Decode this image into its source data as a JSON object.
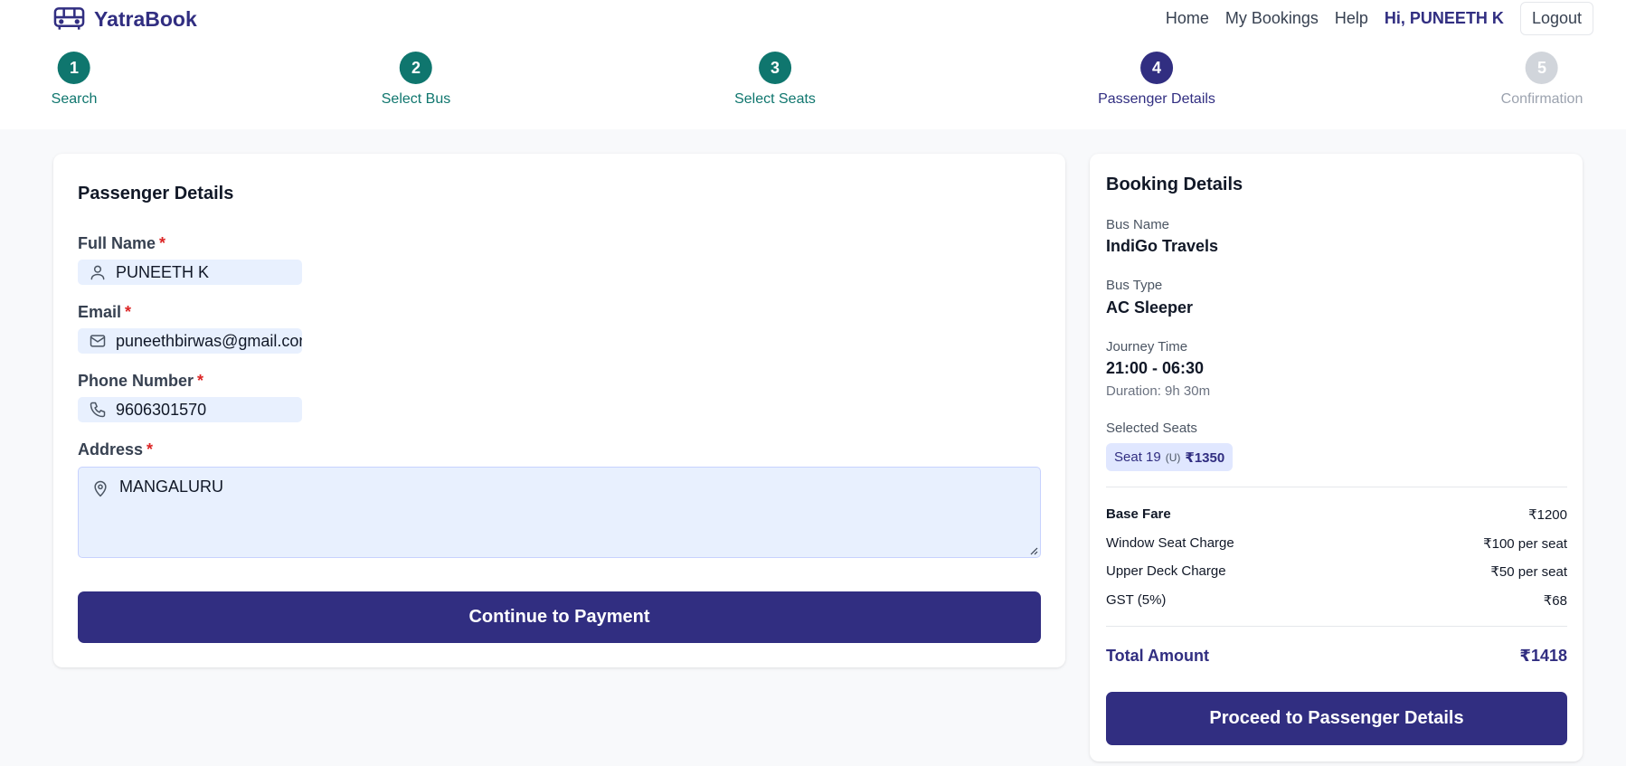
{
  "header": {
    "brand": "YatraBook",
    "nav": [
      "Home",
      "My Bookings",
      "Help"
    ],
    "greeting": "Hi, PUNEETH K",
    "logout_label": "Logout"
  },
  "steps": [
    {
      "number": "1",
      "label": "Search",
      "state": "done"
    },
    {
      "number": "2",
      "label": "Select Bus",
      "state": "done"
    },
    {
      "number": "3",
      "label": "Select Seats",
      "state": "done"
    },
    {
      "number": "4",
      "label": "Passenger Details",
      "state": "active"
    },
    {
      "number": "5",
      "label": "Confirmation",
      "state": "pending"
    }
  ],
  "form": {
    "title": "Passenger Details",
    "required_mark": "*",
    "full_name": {
      "label": "Full Name",
      "value": "PUNEETH K"
    },
    "email": {
      "label": "Email",
      "value": "puneethbirwas@gmail.com"
    },
    "phone": {
      "label": "Phone Number",
      "value": "9606301570"
    },
    "address": {
      "label": "Address",
      "value": "MANGALURU"
    },
    "continue_label": "Continue to Payment"
  },
  "booking": {
    "title": "Booking Details",
    "bus_name_label": "Bus Name",
    "bus_name": "IndiGo Travels",
    "bus_type_label": "Bus Type",
    "bus_type": "AC Sleeper",
    "journey_label": "Journey Time",
    "journey_time": "21:00 - 06:30",
    "duration": "Duration: 9h 30m",
    "seats_label": "Selected Seats",
    "seat": {
      "name": "Seat 19",
      "deck": "(U)",
      "price": "₹1350"
    },
    "fares": [
      {
        "name": "Base Fare",
        "value": "₹1200"
      },
      {
        "name": "Window Seat Charge",
        "value": "₹100 per seat"
      },
      {
        "name": "Upper Deck Charge",
        "value": "₹50 per seat"
      },
      {
        "name": "GST (5%)",
        "value": "₹68"
      }
    ],
    "total_label": "Total Amount",
    "total_value": "₹1418",
    "proceed_label": "Proceed to Passenger Details"
  },
  "colors": {
    "primary": "#312e81",
    "done": "#0f766e",
    "pending": "#d1d5db",
    "input_bg": "#e8f0fe",
    "required": "#dc2626"
  }
}
